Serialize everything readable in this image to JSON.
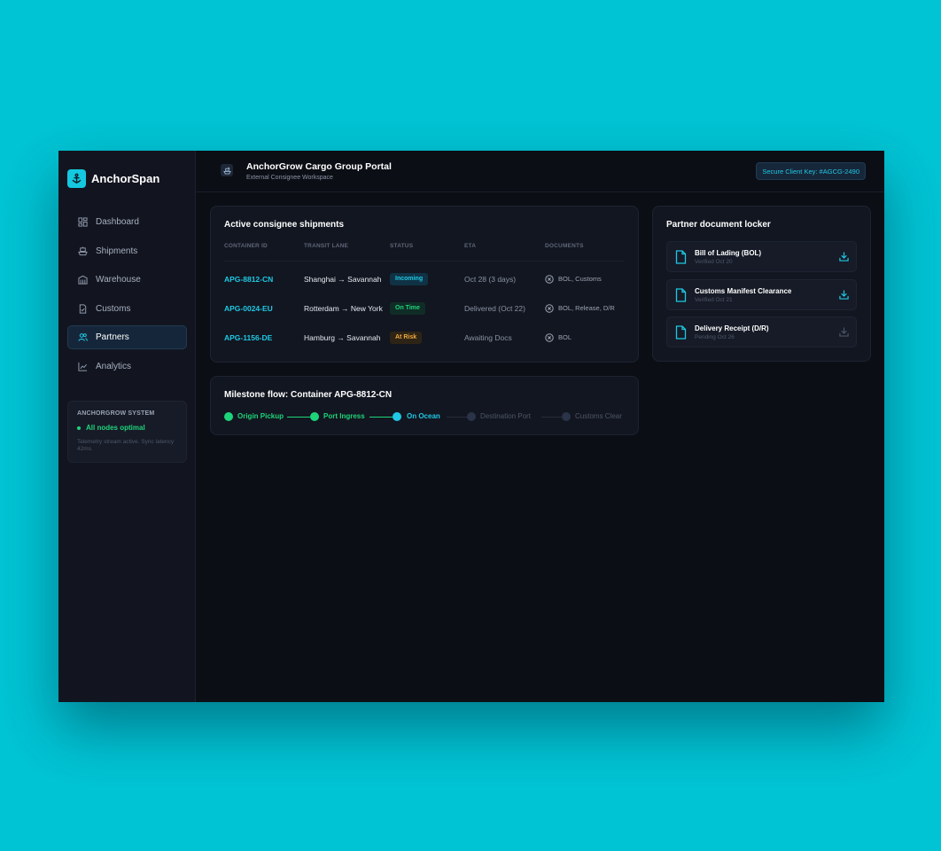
{
  "brand": {
    "name": "AnchorSpan"
  },
  "nav": [
    {
      "label": "Dashboard",
      "icon": "dashboard-icon",
      "active": false
    },
    {
      "label": "Shipments",
      "icon": "ship-icon",
      "active": false
    },
    {
      "label": "Warehouse",
      "icon": "warehouse-icon",
      "active": false
    },
    {
      "label": "Customs",
      "icon": "customs-doc-icon",
      "active": false
    },
    {
      "label": "Partners",
      "icon": "partners-icon",
      "active": true
    },
    {
      "label": "Analytics",
      "icon": "analytics-icon",
      "active": false
    }
  ],
  "system": {
    "title": "ANCHORGROW SYSTEM",
    "status": "All nodes optimal",
    "note": "Telemetry stream active. Sync latency 42ms."
  },
  "header": {
    "title": "AnchorGrow Cargo Group Portal",
    "subtitle": "External Consignee Workspace",
    "client_key": "Secure Client Key: #AGCG-2490"
  },
  "shipments": {
    "title": "Active consignee shipments",
    "columns": [
      "CONTAINER ID",
      "TRANSIT LANE",
      "STATUS",
      "ETA",
      "DOCUMENTS"
    ],
    "rows": [
      {
        "id": "APG-8812-CN",
        "lane": "Shanghai → Savannah",
        "status": "Incoming",
        "eta": "Oct 28 (3 days)",
        "docs": "BOL, Customs"
      },
      {
        "id": "APG-0024-EU",
        "lane": "Rotterdam → New York",
        "status": "On Time",
        "eta": "Delivered (Oct 22)",
        "docs": "BOL, Release, D/R"
      },
      {
        "id": "APG-1156-DE",
        "lane": "Hamburg → Savannah",
        "status": "At Risk",
        "eta": "Awaiting Docs",
        "docs": "BOL"
      }
    ]
  },
  "milestone": {
    "title": "Milestone flow: Container APG-8812-CN",
    "steps": [
      {
        "label": "Origin Pickup",
        "state": "done"
      },
      {
        "label": "Port Ingress",
        "state": "done"
      },
      {
        "label": "On Ocean",
        "state": "current"
      },
      {
        "label": "Destination Port",
        "state": "pending"
      },
      {
        "label": "Customs Clear",
        "state": "pending"
      }
    ]
  },
  "locker": {
    "title": "Partner document locker",
    "docs": [
      {
        "name": "Bill of Lading (BOL)",
        "meta": "Verified Oct 20",
        "available": true
      },
      {
        "name": "Customs Manifest Clearance",
        "meta": "Verified Oct 21",
        "available": true
      },
      {
        "name": "Delivery Receipt (D/R)",
        "meta": "Pending Oct 26",
        "available": false
      }
    ]
  },
  "colors": {
    "accent": "#1fc8e4",
    "success": "#1ed47a",
    "warning": "#f2a93b",
    "background": "#00c4d4",
    "panel": "#121620"
  }
}
